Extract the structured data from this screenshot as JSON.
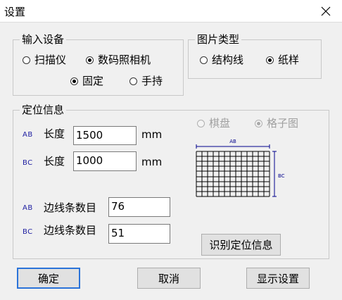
{
  "window": {
    "title": "设置"
  },
  "input_device": {
    "legend": "输入设备",
    "options": [
      {
        "label": "扫描仪",
        "checked": false
      },
      {
        "label": "数码照相机",
        "checked": true
      }
    ],
    "mount_options": [
      {
        "label": "固定",
        "checked": true
      },
      {
        "label": "手持",
        "checked": false
      }
    ]
  },
  "image_type": {
    "legend": "图片类型",
    "options": [
      {
        "label": "结构线",
        "checked": false
      },
      {
        "label": "纸样",
        "checked": true
      }
    ]
  },
  "positioning": {
    "legend": "定位信息",
    "pattern_options": [
      {
        "label": "棋盘",
        "checked": false,
        "disabled": true
      },
      {
        "label": "格子图",
        "checked": true,
        "disabled": true
      }
    ],
    "ab_tag": "AB",
    "bc_tag": "BC",
    "length_label": "长度",
    "ab_length": "1500",
    "bc_length": "1000",
    "unit": "mm",
    "edge_count_label": "边线条数目",
    "ab_edge_count": "76",
    "bc_edge_count": "51",
    "diagram": {
      "top_label": "AB",
      "side_label": "BC",
      "line_color": "#00008b"
    },
    "recognize_button": "识别定位信息"
  },
  "footer": {
    "ok_button": "确定",
    "cancel_button": "取消",
    "display_settings_button": "显示设置"
  }
}
